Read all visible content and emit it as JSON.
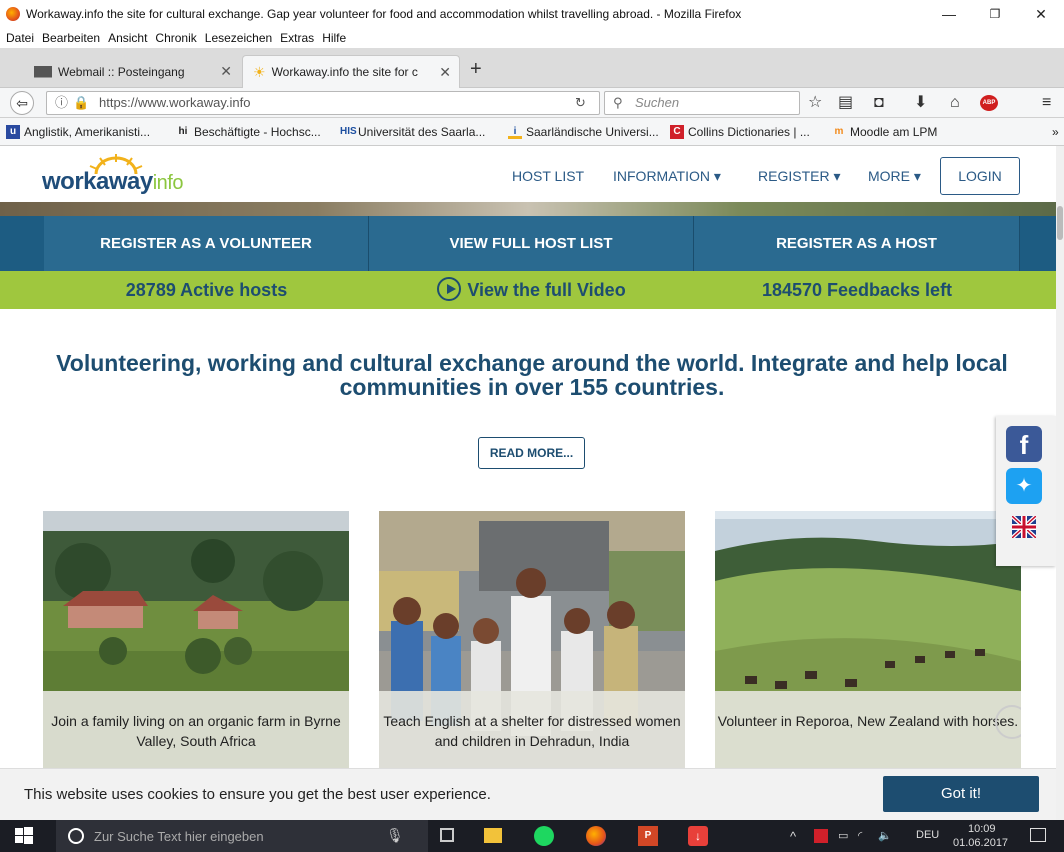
{
  "window": {
    "title": "Workaway.info the site for cultural exchange. Gap year volunteer for food and accommodation whilst travelling abroad. - Mozilla Firefox"
  },
  "menu": [
    "Datei",
    "Bearbeiten",
    "Ansicht",
    "Chronik",
    "Lesezeichen",
    "Extras",
    "Hilfe"
  ],
  "tabs": [
    {
      "label": "Webmail :: Posteingang"
    },
    {
      "label": "Workaway.info the site for c"
    }
  ],
  "nav": {
    "url": "https://www.workaway.info",
    "search_placeholder": "Suchen",
    "abp_label": "ABP"
  },
  "bookmarks": [
    "Anglistik, Amerikanisti...",
    "Beschäftigte - Hochsc...",
    "Universität des Saarla...",
    "Saarländische Universi...",
    "Collins Dictionaries | ...",
    "Moodle am LPM"
  ],
  "site": {
    "logo_main": "workaway",
    "logo_suffix": "info",
    "nav_links": [
      "HOST LIST",
      "INFORMATION ▾",
      "REGISTER ▾",
      "MORE ▾"
    ],
    "login": "LOGIN",
    "register_bar": [
      "REGISTER AS A VOLUNTEER",
      "VIEW FULL HOST LIST",
      "REGISTER AS A HOST"
    ],
    "stats": {
      "hosts": "28789 Active hosts",
      "video": "View the full Video",
      "feedbacks": "184570 Feedbacks left"
    },
    "headline": "Volunteering, working and cultural exchange around the world. Integrate and help local communities in over 155 countries.",
    "read_more": "READ MORE...",
    "cards": [
      {
        "caption": "Join a family living on an organic farm in Byrne Valley, South Africa"
      },
      {
        "caption": "Teach English at a shelter for distressed women and children in Dehradun, India"
      },
      {
        "caption": "Volunteer in Reporoa, New Zealand with horses."
      }
    ],
    "social": [
      "facebook-icon",
      "twitter-icon",
      "uk-flag-icon"
    ],
    "cookie": {
      "text": "This website uses cookies to ensure you get the best user experience.",
      "button": "Got it!"
    }
  },
  "taskbar": {
    "search_placeholder": "Zur Suche Text hier eingeben",
    "lang": "DEU",
    "time": "10:09",
    "date": "01.06.2017"
  },
  "colors": {
    "brand_blue": "#1d4d70",
    "brand_green": "#9fc73e",
    "reg_bar": "#2a6a90"
  }
}
